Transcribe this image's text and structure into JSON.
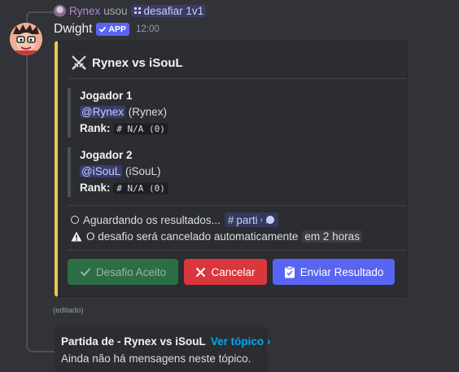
{
  "reply": {
    "user": "Rynex",
    "action": "usou",
    "command": "desafiar 1v1"
  },
  "message": {
    "author": "Dwight",
    "badge": "APP",
    "timestamp": "12:00",
    "edited": "(editado)"
  },
  "embed": {
    "title": "Rynex vs iSouL",
    "accent_color": "#e7c84f",
    "players": [
      {
        "heading": "Jogador 1",
        "mention": "@Rynex",
        "name": "(Rynex)",
        "rank_label": "Rank:",
        "rank": "# N/A (0)"
      },
      {
        "heading": "Jogador 2",
        "mention": "@iSouL",
        "name": "(iSouL)",
        "rank_label": "Rank:",
        "rank": "# N/A (0)"
      }
    ],
    "status_waiting": "Aguardando os resultados...",
    "channel": "parti",
    "warning_text": "O desafio será cancelado automaticamente",
    "warning_time": "em 2 horas"
  },
  "buttons": {
    "accept": "Desafio Aceito",
    "cancel": "Cancelar",
    "submit": "Enviar Resultado"
  },
  "thread": {
    "title": "Partida de - Rynex vs iSouL",
    "link": "Ver tópico ›",
    "subtitle": "Ainda não há mensagens neste tópico."
  }
}
